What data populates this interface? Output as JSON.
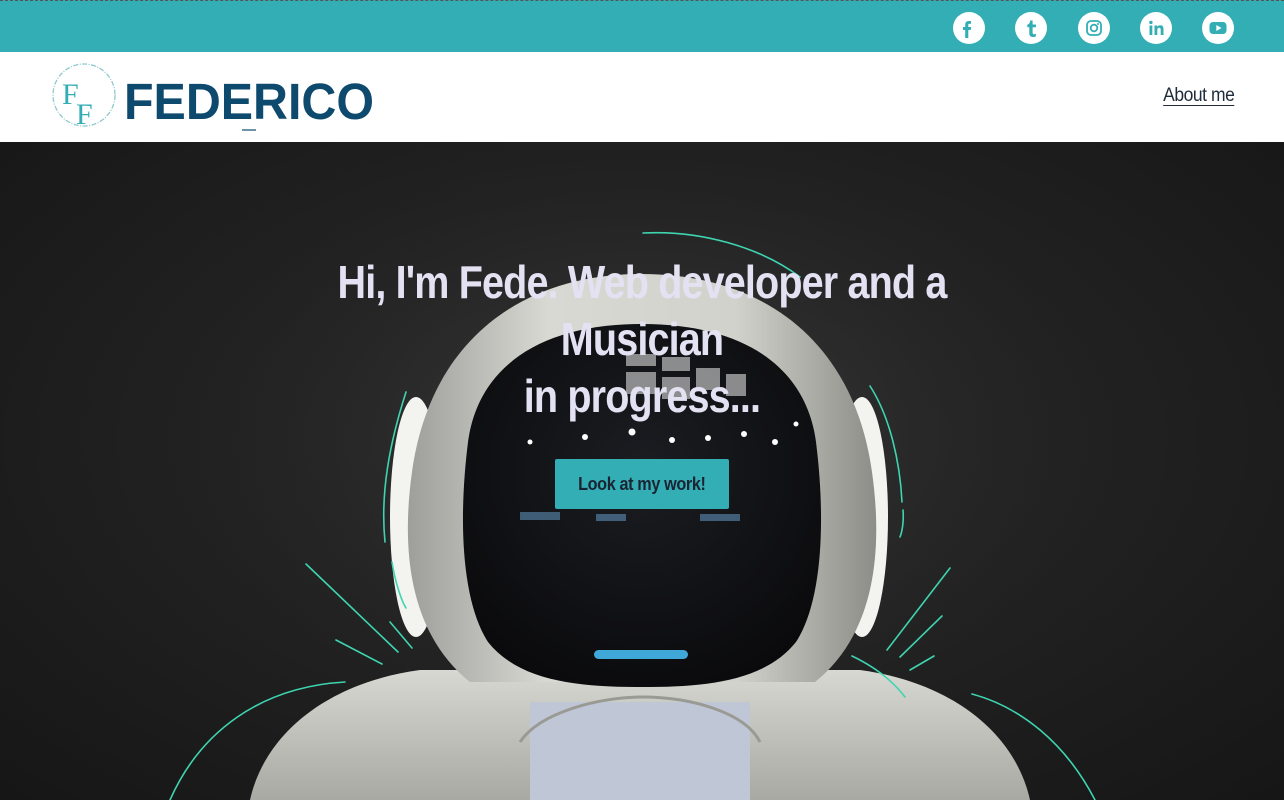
{
  "social": {
    "facebook": "f",
    "tumblr": "t",
    "instagram": "instagram-icon",
    "linkedin": "in",
    "youtube": "youtube-icon"
  },
  "header": {
    "logo_monogram": "FF",
    "logo_text": "FEDERICO",
    "nav_about": "About me"
  },
  "hero": {
    "headline_line1": "Hi, I'm Fede. Web developer and a Musician",
    "headline_line2": "in progress...",
    "cta_label": "Look at my work!"
  },
  "colors": {
    "accent": "#32aeb4",
    "logo_dark": "#0d4a6e",
    "headline": "#e3e1f2",
    "nav_text": "#1f2b3a",
    "sketch_lines": "#3fd4b0"
  }
}
